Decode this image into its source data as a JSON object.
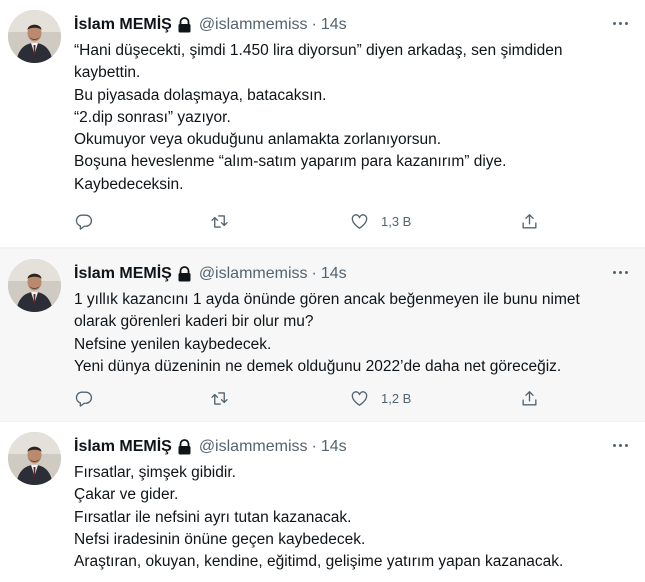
{
  "tweets": [
    {
      "name": "İslam MEMİŞ",
      "handle": "@islammemiss",
      "separator": "·",
      "time": "14s",
      "lines": [
        "“Hani düşecekti, şimdi 1.450 lira diyorsun” diyen arkadaş, sen şimdiden",
        "kaybettin.",
        "Bu piyasada dolaşmaya, batacaksın.",
        "“2.dip sonrası” yazıyor.",
        "Okumuyor veya okuduğunu anlamakta zorlanıyorsun.",
        "Boşuna heveslenme “alım-satım yaparım para kazanırım” diye.",
        "Kaybedeceksin."
      ],
      "likes": "1,3 B"
    },
    {
      "name": "İslam MEMİŞ",
      "handle": "@islammemiss",
      "separator": "·",
      "time": "14s",
      "lines": [
        "1 yıllık kazancını 1 ayda önünde gören ancak beğenmeyen ile bunu nimet",
        "olarak görenleri kaderi bir olur mu?",
        "Nefsine yenilen kaybedecek.",
        "Yeni dünya düzeninin ne demek olduğunu 2022’de daha net göreceğiz."
      ],
      "likes": "1,2 B"
    },
    {
      "name": "İslam MEMİŞ",
      "handle": "@islammemiss",
      "separator": "·",
      "time": "14s",
      "lines": [
        "Fırsatlar, şimşek gibidir.",
        "Çakar ve gider.",
        "Fırsatlar ile nefsini ayrı tutan kazanacak.",
        "Nefsi iradesinin önüne geçen kaybedecek.",
        "Araştıran, okuyan, kendine, eğitimd, gelişime yatırım yapan kazanacak."
      ]
    }
  ],
  "icons": {
    "reply": "reply-icon",
    "retweet": "retweet-icon",
    "like": "like-icon",
    "share": "share-icon",
    "lock": "lock-icon",
    "more": "more-icon"
  },
  "colors": {
    "text": "#0f1419",
    "secondary": "#536471",
    "highlight_bg": "#f7f7f7"
  }
}
